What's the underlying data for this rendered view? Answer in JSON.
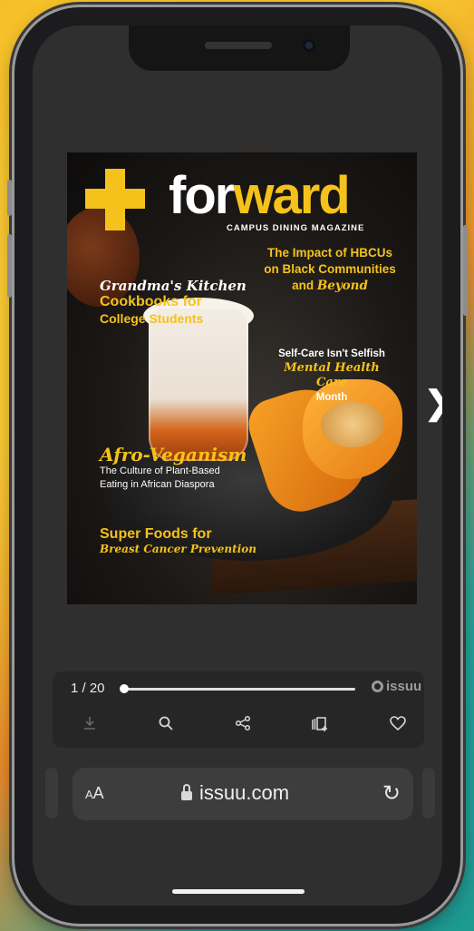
{
  "magazine": {
    "brand_prefix": "for",
    "brand_suffix": "ward",
    "subtitle": "CAMPUS DINING MAGAZINE",
    "headlines": {
      "hbcus_line1": "The Impact of HBCUs",
      "hbcus_line2": "on Black Communities",
      "hbcus_line3a": "and ",
      "hbcus_line3b": "Beyond",
      "grandma_script": "Grandma's Kitchen",
      "grandma_line1": "Cookbooks for",
      "grandma_line2": "College Students",
      "selfcare_line1": "Self-Care Isn't Selfish",
      "selfcare_script": "Mental Health Care",
      "selfcare_line3": "Month",
      "vegan_script": "Afro-Veganism",
      "vegan_line1": "The Culture of Plant-Based",
      "vegan_line2": "Eating in African Diaspora",
      "superfoods_line1": "Super Foods for",
      "superfoods_script": "Breast Cancer Prevention"
    }
  },
  "reader": {
    "page_indicator": "1 / 20",
    "progress": 0.0,
    "brand_name": "issuu",
    "icons": [
      "download-icon",
      "search-icon",
      "share-icon",
      "add-to-stack-icon",
      "heart-icon"
    ]
  },
  "browser": {
    "text_size_label_small": "A",
    "text_size_label_large": "A",
    "url": "issuu.com"
  },
  "colors": {
    "accent_yellow": "#f5c21b",
    "screen_bg": "#2f2f2f"
  }
}
